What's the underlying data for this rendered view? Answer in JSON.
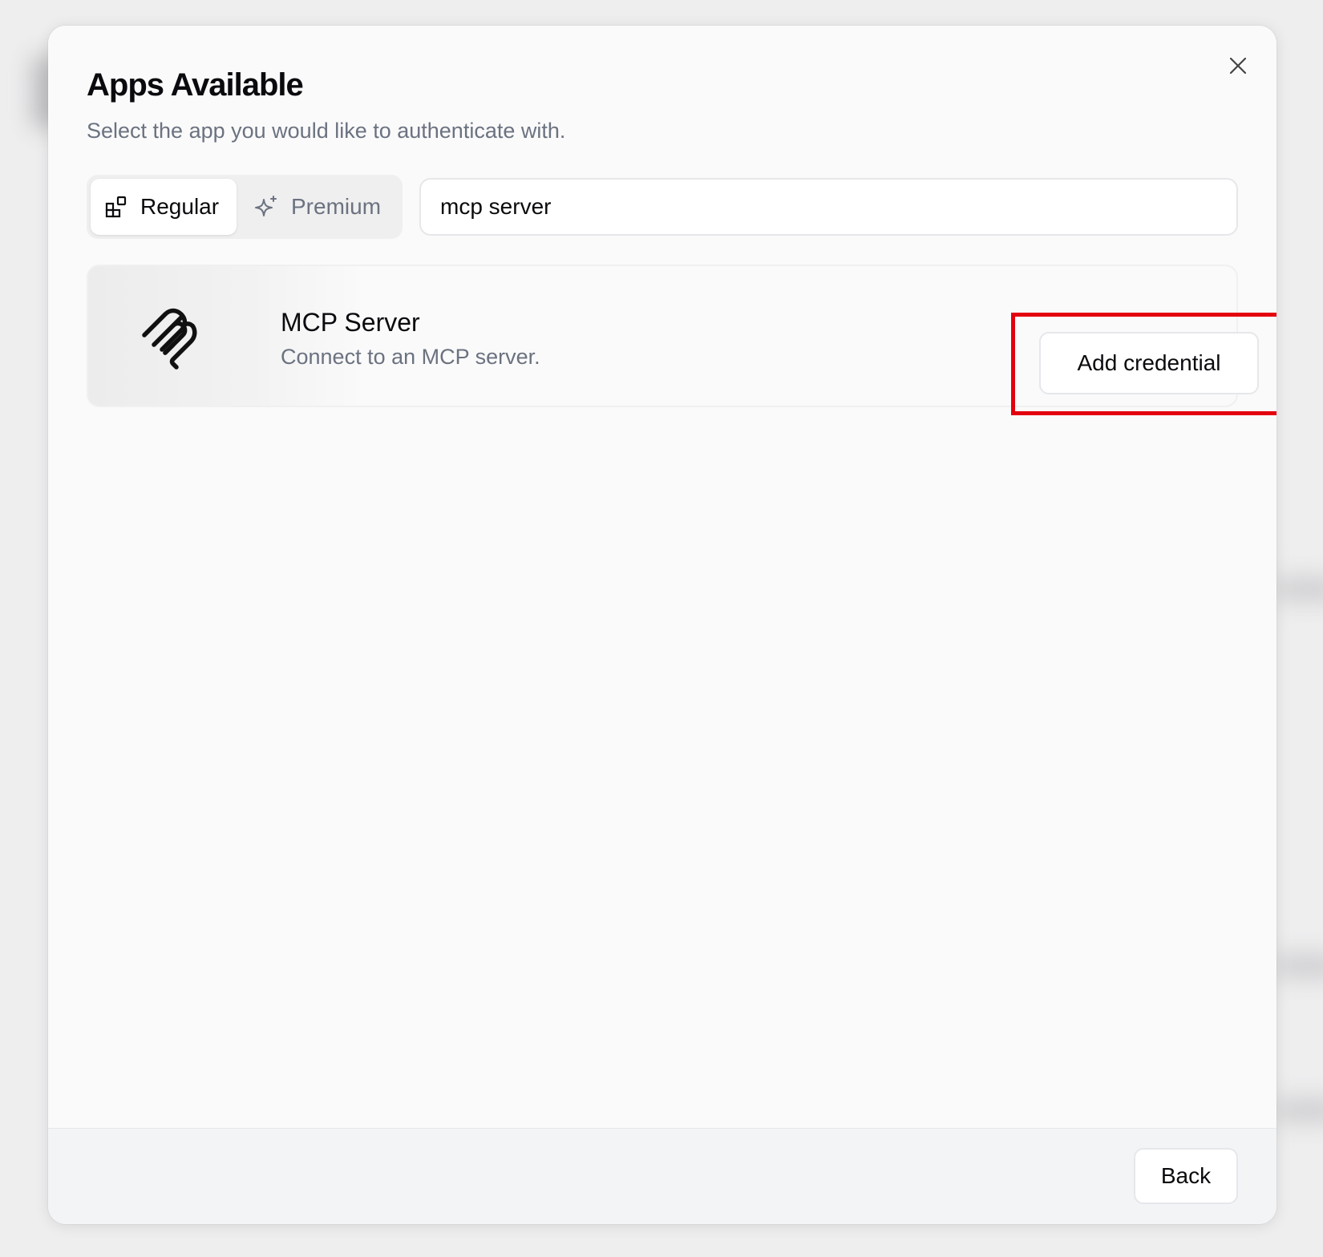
{
  "modal": {
    "title": "Apps Available",
    "subtitle": "Select the app you would like to authenticate with.",
    "close_icon": "close-icon"
  },
  "tabs": [
    {
      "label": "Regular",
      "icon": "apps-grid-icon",
      "active": true
    },
    {
      "label": "Premium",
      "icon": "sparkles-icon",
      "active": false
    }
  ],
  "search": {
    "value": "mcp server",
    "placeholder": ""
  },
  "apps": [
    {
      "name": "MCP Server",
      "description": "Connect to an MCP server.",
      "logo": "mcp-logo-icon",
      "action_label": "Add credential"
    }
  ],
  "footer": {
    "back_label": "Back"
  },
  "colors": {
    "highlight": "#e3000f",
    "muted_text": "#6b7280",
    "text": "#0b0b0f"
  }
}
